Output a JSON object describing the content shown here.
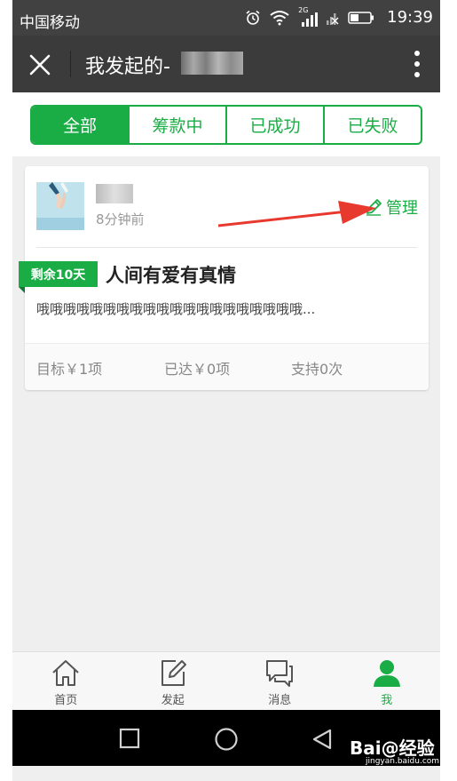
{
  "status_bar": {
    "carrier": "中国移动",
    "signal_label": "2G",
    "time": "19:39"
  },
  "header": {
    "title": "我发起的-"
  },
  "tabs": [
    {
      "label": "全部",
      "active": true
    },
    {
      "label": "筹款中",
      "active": false
    },
    {
      "label": "已成功",
      "active": false
    },
    {
      "label": "已失败",
      "active": false
    }
  ],
  "card": {
    "time_ago": "8分钟前",
    "manage_label": "管理",
    "remaining_badge": "剩余10天",
    "title": "人间有爱有真情",
    "description": "哦哦哦哦哦哦哦哦哦哦哦哦哦哦哦哦哦哦哦哦...",
    "stats": {
      "goal": "目标￥1项",
      "reached": "已达￥0项",
      "support": "支持0次"
    }
  },
  "bottom_nav": [
    {
      "label": "首页",
      "icon": "home-icon",
      "active": false
    },
    {
      "label": "发起",
      "icon": "edit-icon",
      "active": false
    },
    {
      "label": "消息",
      "icon": "message-icon",
      "active": false
    },
    {
      "label": "我",
      "icon": "user-icon",
      "active": true
    }
  ],
  "watermark": {
    "text": "Bai@经验",
    "sub": "jingyan.baidu.com"
  },
  "colors": {
    "accent": "#1aad45",
    "title_bar": "#3b3b3b",
    "arrow": "#e8392f"
  }
}
